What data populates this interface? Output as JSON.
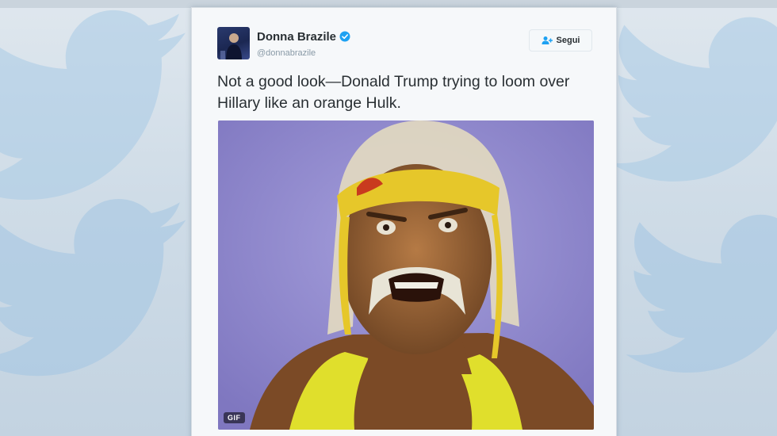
{
  "tweet": {
    "author_name": "Donna Brazile",
    "author_handle": "@donnabrazile",
    "verified": true,
    "follow_label": "Segui",
    "text": "Not a good look—Donald Trump trying to loom over Hillary like an orange Hulk.",
    "media": {
      "type": "gif",
      "badge": "GIF"
    }
  },
  "icons": {
    "verified": "verified-badge-icon",
    "follow": "follow-person-plus-icon",
    "background": "twitter-bird-icon"
  },
  "colors": {
    "accent": "#1da1f2",
    "background_bird": "#9fc3e0",
    "card": "#f6f8fa",
    "text": "#292f33",
    "muted": "#8899a6"
  }
}
